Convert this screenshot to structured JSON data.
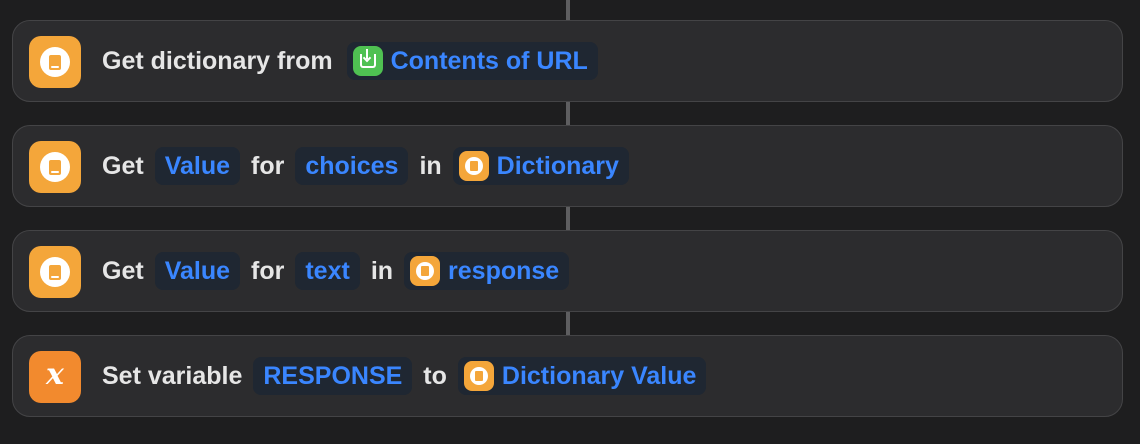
{
  "colors": {
    "background": "#1e1e1f",
    "card": "#2c2c2e",
    "token_text": "#3a86ff",
    "dictionary_icon": "#f4a63a",
    "variable_icon": "#f28a2e",
    "url_icon": "#4fc152"
  },
  "actions": [
    {
      "icon": "dictionary-icon",
      "label_1": "Get dictionary from",
      "token_1": {
        "icon": "download-icon",
        "text": "Contents of URL"
      }
    },
    {
      "icon": "dictionary-icon",
      "label_1": "Get",
      "token_1": "Value",
      "label_2": "for",
      "token_2": "choices",
      "label_3": "in",
      "token_3": {
        "icon": "dictionary-icon",
        "text": "Dictionary"
      }
    },
    {
      "icon": "dictionary-icon",
      "label_1": "Get",
      "token_1": "Value",
      "label_2": "for",
      "token_2": "text",
      "label_3": "in",
      "token_3": {
        "icon": "dictionary-icon",
        "text": "response"
      }
    },
    {
      "icon": "variable-icon",
      "glyph": "x",
      "label_1": "Set variable",
      "token_1": "RESPONSE",
      "label_2": "to",
      "token_2": {
        "icon": "dictionary-icon",
        "text": "Dictionary Value"
      }
    }
  ]
}
